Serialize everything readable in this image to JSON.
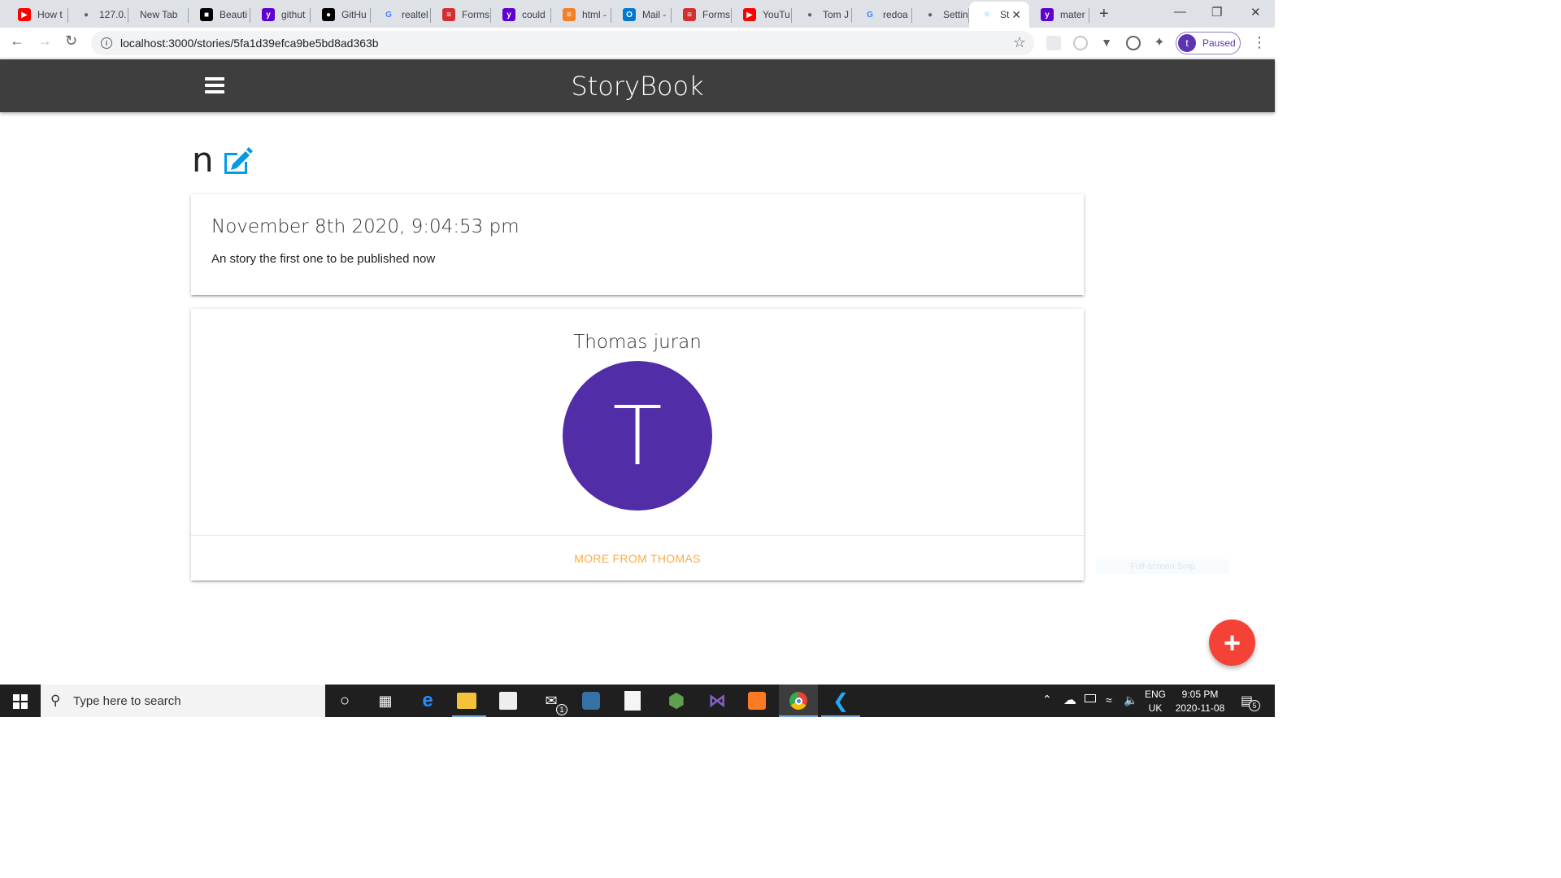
{
  "browser": {
    "tabs": [
      {
        "title": "How t",
        "icon": "youtube-icon",
        "color": "#ff0000"
      },
      {
        "title": "127.0.",
        "icon": "globe-icon",
        "color": "#5f6368"
      },
      {
        "title": "New Tab",
        "icon": "",
        "color": ""
      },
      {
        "title": "Beauti",
        "icon": "unsplash-icon",
        "color": "#000000"
      },
      {
        "title": "githut",
        "icon": "yahoo-icon",
        "color": "#5f01d1"
      },
      {
        "title": "GitHu",
        "icon": "github-icon",
        "color": "#000000"
      },
      {
        "title": "realtel",
        "icon": "google-icon",
        "color": "#4285f4"
      },
      {
        "title": "Forms",
        "icon": "forms-icon",
        "color": "#d32f2f"
      },
      {
        "title": "could",
        "icon": "yahoo-icon",
        "color": "#5f01d1"
      },
      {
        "title": "html -",
        "icon": "stackoverflow-icon",
        "color": "#f48024"
      },
      {
        "title": "Mail -",
        "icon": "outlook-icon",
        "color": "#0078d4"
      },
      {
        "title": "Forms",
        "icon": "forms-icon",
        "color": "#d32f2f"
      },
      {
        "title": "YouTu",
        "icon": "youtube-icon",
        "color": "#ff0000"
      },
      {
        "title": "Tom J",
        "icon": "globe-icon",
        "color": "#5f6368"
      },
      {
        "title": "redoa",
        "icon": "google-icon",
        "color": "#4285f4"
      },
      {
        "title": "Settin",
        "icon": "globe-icon",
        "color": "#5f6368"
      },
      {
        "title": "St",
        "icon": "react-icon",
        "color": "#61dafb",
        "active": true
      },
      {
        "title": "mater",
        "icon": "yahoo-icon",
        "color": "#5f01d1"
      }
    ],
    "url": "localhost:3000/stories/5fa1d39efca9be5bd8ad363b",
    "profile": {
      "initial": "t",
      "status": "Paused"
    }
  },
  "app": {
    "brand": "StoryBook",
    "story": {
      "title": "n",
      "date": "November 8th 2020, 9:04:53 pm",
      "body": "An story the first one to be published now"
    },
    "author": {
      "name": "Thomas juran",
      "initial": "T",
      "avatar_color": "#512da8",
      "more_label": "MORE FROM THOMAS"
    },
    "fab_label": "+",
    "snip_hint": "Full-screen Snip"
  },
  "taskbar": {
    "search_placeholder": "Type here to search",
    "lang": "ENG",
    "region": "UK",
    "time": "9:05 PM",
    "date": "2020-11-08",
    "notifications": "5",
    "mail_badge": "1"
  },
  "colors": {
    "appbar": "#3e3e3e",
    "edit_icon": "#039be5",
    "more_link": "#ffab40",
    "fab": "#f44336"
  }
}
